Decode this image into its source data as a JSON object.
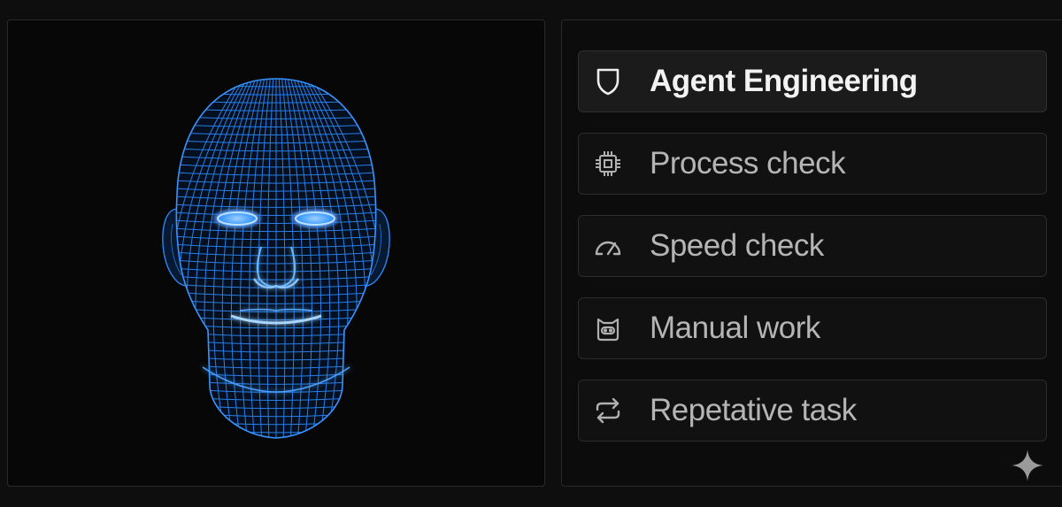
{
  "menu": {
    "items": [
      {
        "label": "Agent Engineering",
        "icon": "shield-icon",
        "active": true
      },
      {
        "label": "Process check",
        "icon": "cpu-chip-icon",
        "active": false
      },
      {
        "label": "Speed check",
        "icon": "speedometer-icon",
        "active": false
      },
      {
        "label": "Manual work",
        "icon": "robot-icon",
        "active": false
      },
      {
        "label": "Repetative task",
        "icon": "repeat-icon",
        "active": false
      }
    ]
  },
  "visual": {
    "image": "wireframe-head-illustration",
    "accent_color": "#2f8cff"
  },
  "corner_mark": "sparkle-icon"
}
